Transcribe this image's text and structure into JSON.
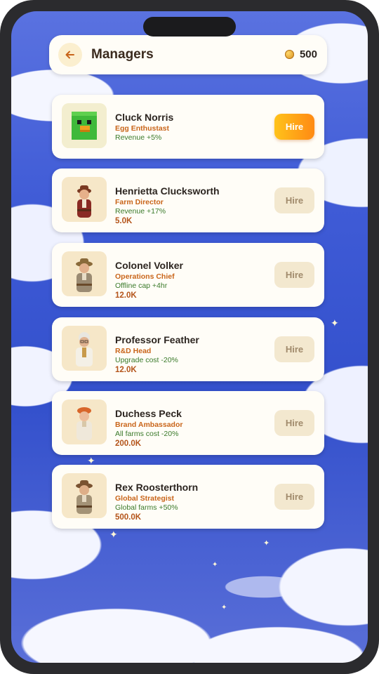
{
  "header": {
    "title": "Managers",
    "coins": "500"
  },
  "managers": [
    {
      "name": "Cluck Norris",
      "role": "Egg Enthustast",
      "effect": "Revenue +5%",
      "cost": "",
      "hire_label": "Hire",
      "hire_enabled": true
    },
    {
      "name": "Henrietta Clucksworth",
      "role": "Farm Director",
      "effect": "Revenue +17%",
      "cost": "5.0K",
      "hire_label": "Hire",
      "hire_enabled": false
    },
    {
      "name": "Colonel Volker",
      "role": "Operations Chief",
      "effect": "Offline cap +4hr",
      "cost": "12.0K",
      "hire_label": "Hire",
      "hire_enabled": false
    },
    {
      "name": "Professor Feather",
      "role": "R&D Head",
      "effect": "Upgrade cost -20%",
      "cost": "12.0K",
      "hire_label": "Hire",
      "hire_enabled": false
    },
    {
      "name": "Duchess Peck",
      "role": "Brand Ambassador",
      "effect": "All farms cost -20%",
      "cost": "200.0K",
      "hire_label": "Hire",
      "hire_enabled": false
    },
    {
      "name": "Rex Roosterthorn",
      "role": "Global Strategist",
      "effect": "Global farms +50%",
      "cost": "500.0K",
      "hire_label": "Hire",
      "hire_enabled": false
    }
  ],
  "colors": {
    "accent_gradient_start": "#ffc21a",
    "accent_gradient_end": "#ff8a14",
    "role_orange": "#c9651a",
    "effect_green": "#3a7a2a",
    "sky_blue": "#3f5bd6"
  }
}
